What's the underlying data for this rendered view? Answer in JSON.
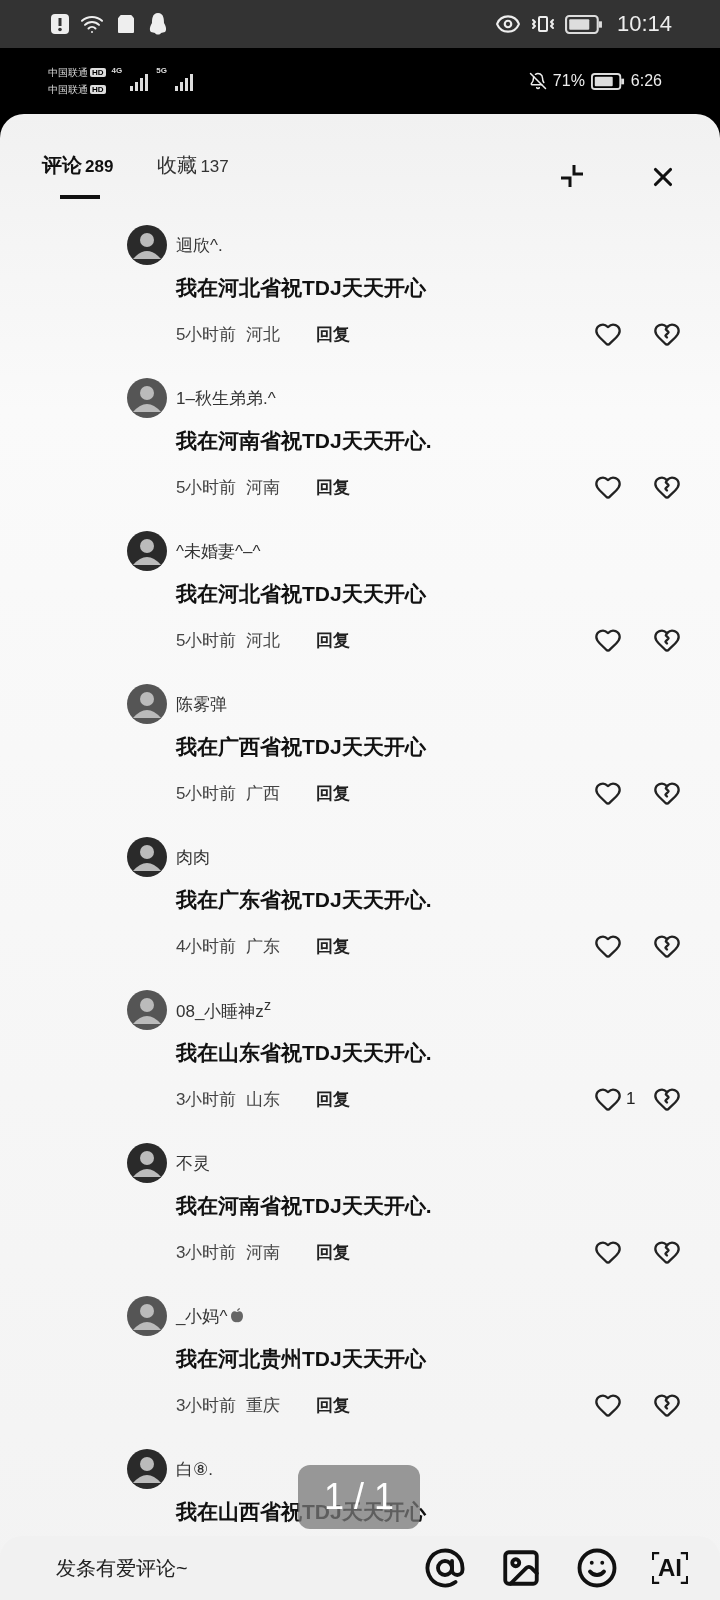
{
  "outer_status": {
    "time": "10:14"
  },
  "inner_status": {
    "carriers": [
      {
        "name": "中国联通",
        "badge": "HD"
      },
      {
        "name": "中国联通",
        "badge": "HD"
      }
    ],
    "networks": [
      "4G",
      "5G"
    ],
    "battery": "71%",
    "time": "6:26"
  },
  "tabs": [
    {
      "label": "评论",
      "count": "289",
      "selected": true
    },
    {
      "label": "收藏",
      "count": "137",
      "selected": false
    }
  ],
  "comments": [
    {
      "user": "迴欣^.",
      "text": "我在河北省祝TDJ天天开心",
      "time": "5小时前",
      "region": "河北",
      "reply": "回复"
    },
    {
      "user": "1–秋生弟弟.^",
      "text": "我在河南省祝TDJ天天开心.",
      "time": "5小时前",
      "region": "河南",
      "reply": "回复"
    },
    {
      "user": "^未婚妻^–^",
      "text": "我在河北省祝TDJ天天开心",
      "time": "5小时前",
      "region": "河北",
      "reply": "回复"
    },
    {
      "user": "陈雾弹",
      "text": "我在广西省祝TDJ天天开心",
      "time": "5小时前",
      "region": "广西",
      "reply": "回复"
    },
    {
      "user": "肉肉",
      "text": "我在广东省祝TDJ天天开心.",
      "time": "4小时前",
      "region": "广东",
      "reply": "回复"
    },
    {
      "user": "08_小睡神z$^{z}$",
      "text": "我在山东省祝TDJ天天开心.",
      "time": "3小时前",
      "region": "山东",
      "reply": "回复",
      "likes": "1"
    },
    {
      "user": "不灵",
      "text": "我在河南省祝TDJ天天开心.",
      "time": "3小时前",
      "region": "河南",
      "reply": "回复"
    },
    {
      "user": "_小妈^",
      "apple_badge": true,
      "text": "我在河北贵州TDJ天天开心",
      "time": "3小时前",
      "region": "重庆",
      "reply": "回复"
    },
    {
      "user": "白⑧.",
      "text": "我在山西省祝TDJ天天开心"
    }
  ],
  "page_indicator": "1 / 1",
  "composer": {
    "placeholder": "发条有爱评论~",
    "ai_label": "AI"
  }
}
